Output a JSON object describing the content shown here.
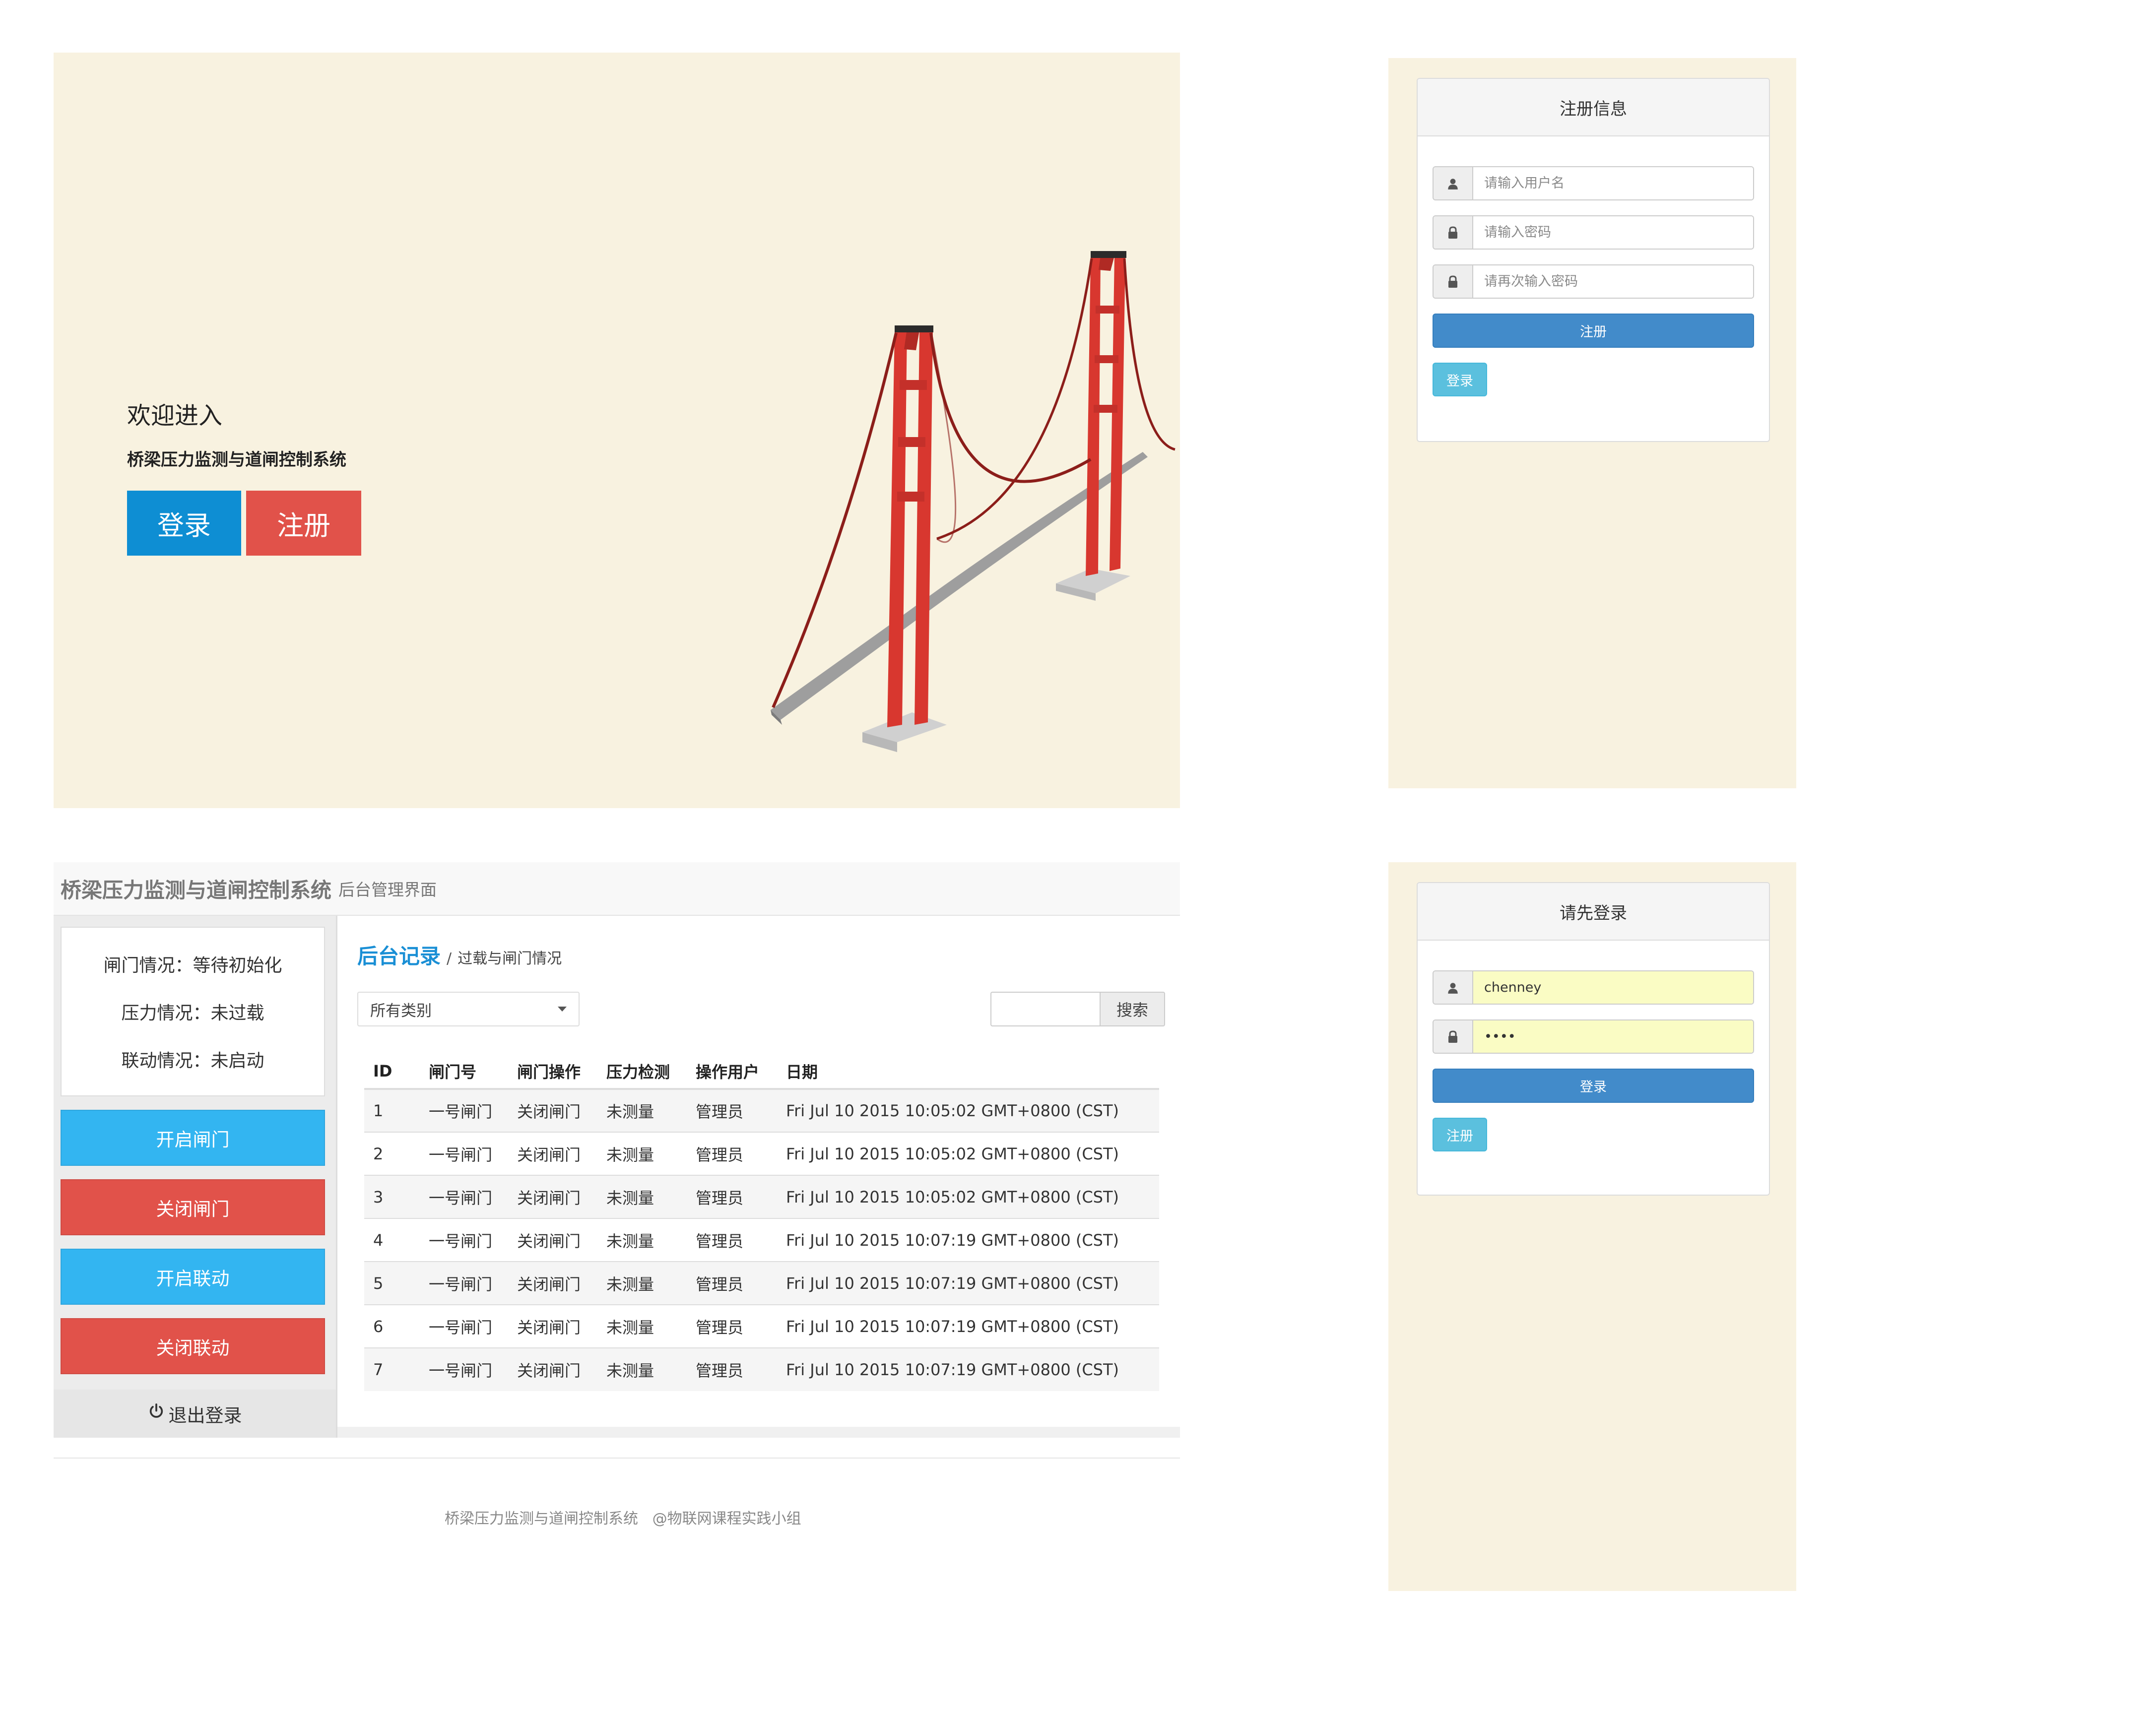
{
  "landing": {
    "welcome": "欢迎进入",
    "subtitle": "桥梁压力监测与道闸控制系统",
    "login_label": "登录",
    "register_label": "注册"
  },
  "register_form": {
    "title": "注册信息",
    "username_placeholder": "请输入用户名",
    "password_placeholder": "请输入密码",
    "password_confirm_placeholder": "请再次输入密码",
    "submit_label": "注册",
    "login_label": "登录"
  },
  "login_form": {
    "title": "请先登录",
    "username_value": "chenney",
    "password_value": "••••",
    "submit_label": "登录",
    "register_label": "注册"
  },
  "admin": {
    "brand": "桥梁压力监测与道闸控制系统",
    "brand_sub": "后台管理界面",
    "status": {
      "gate": "闸门情况：等待初始化",
      "pressure": "压力情况：未过载",
      "linkage": "联动情况：未启动"
    },
    "buttons": {
      "open_gate": "开启闸门",
      "close_gate": "关闭闸门",
      "open_linkage": "开启联动",
      "close_linkage": "关闭联动",
      "logout": "退出登录"
    },
    "content_title": "后台记录",
    "content_separator": "/",
    "content_subtitle": "过载与闸门情况",
    "filter_selected": "所有类别",
    "search_label": "搜索",
    "table": {
      "headers": [
        "ID",
        "闸门号",
        "闸门操作",
        "压力检测",
        "操作用户",
        "日期"
      ],
      "rows": [
        [
          "1",
          "一号闸门",
          "关闭闸门",
          "未测量",
          "管理员",
          "Fri Jul 10 2015 10:05:02 GMT+0800 (CST)"
        ],
        [
          "2",
          "一号闸门",
          "关闭闸门",
          "未测量",
          "管理员",
          "Fri Jul 10 2015 10:05:02 GMT+0800 (CST)"
        ],
        [
          "3",
          "一号闸门",
          "关闭闸门",
          "未测量",
          "管理员",
          "Fri Jul 10 2015 10:05:02 GMT+0800 (CST)"
        ],
        [
          "4",
          "一号闸门",
          "关闭闸门",
          "未测量",
          "管理员",
          "Fri Jul 10 2015 10:07:19 GMT+0800 (CST)"
        ],
        [
          "5",
          "一号闸门",
          "关闭闸门",
          "未测量",
          "管理员",
          "Fri Jul 10 2015 10:07:19 GMT+0800 (CST)"
        ],
        [
          "6",
          "一号闸门",
          "关闭闸门",
          "未测量",
          "管理员",
          "Fri Jul 10 2015 10:07:19 GMT+0800 (CST)"
        ],
        [
          "7",
          "一号闸门",
          "关闭闸门",
          "未测量",
          "管理员",
          "Fri Jul 10 2015 10:07:19 GMT+0800 (CST)"
        ]
      ]
    }
  },
  "footer": {
    "system_name": "桥梁压力监测与道闸控制系统",
    "team": "@物联网课程实践小组"
  },
  "icons": {
    "user": "user-icon",
    "lock": "lock-icon",
    "power": "power-icon",
    "bridge": "bridge-illustration"
  },
  "colors": {
    "cream": "#f8f2e0",
    "primary_blue": "#0e8ed3",
    "danger_red": "#e1524a",
    "sky_blue": "#33b5f1",
    "form_blue": "#428bca",
    "info_blue": "#5bc0de",
    "title_blue": "#1a8fd5"
  }
}
